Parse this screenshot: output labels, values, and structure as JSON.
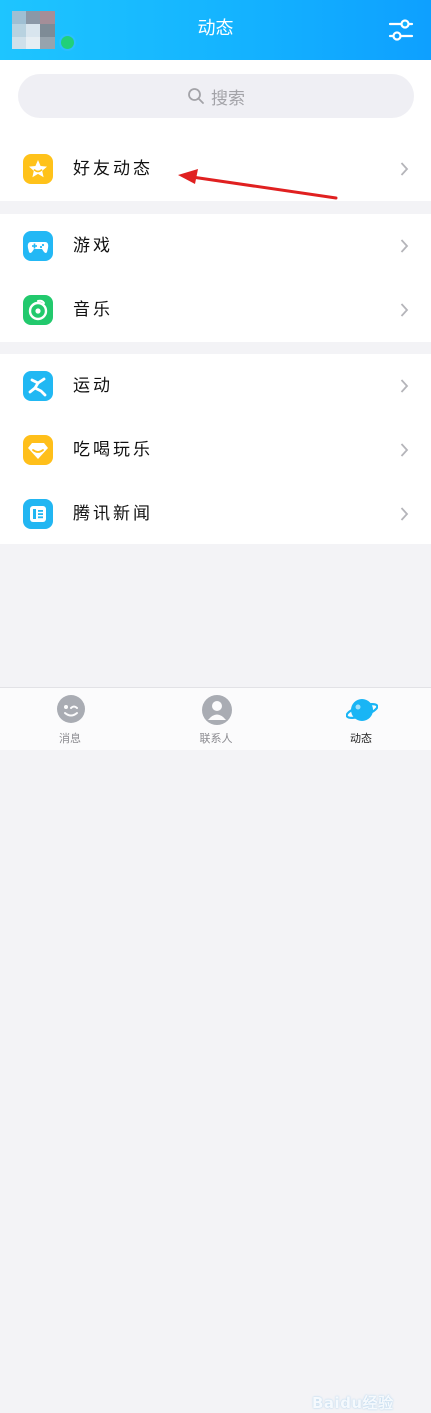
{
  "header": {
    "title": "动态"
  },
  "search": {
    "placeholder": "搜索"
  },
  "groups": [
    {
      "items": [
        {
          "label": "好友动态",
          "icon": "star-icon",
          "color": "#ffc21a"
        }
      ]
    },
    {
      "items": [
        {
          "label": "游戏",
          "icon": "gamepad-icon",
          "color": "#23b8f5"
        },
        {
          "label": "音乐",
          "icon": "music-icon",
          "color": "#22c96d"
        }
      ]
    },
    {
      "items": [
        {
          "label": "运动",
          "icon": "runner-icon",
          "color": "#21b8f3"
        },
        {
          "label": "吃喝玩乐",
          "icon": "diamond-icon",
          "color": "#ffbf1a"
        },
        {
          "label": "腾讯新闻",
          "icon": "news-icon",
          "color": "#22b6f2"
        }
      ]
    }
  ],
  "tabbar": {
    "tabs": [
      {
        "label": "消息",
        "icon": "chat-icon"
      },
      {
        "label": "联系人",
        "icon": "contact-icon"
      },
      {
        "label": "动态",
        "icon": "planet-icon",
        "active": true
      }
    ]
  },
  "watermark": {
    "text": "Baidu经验"
  },
  "colors": {
    "header": "#14b3ff",
    "annotation_arrow": "#e02020"
  }
}
